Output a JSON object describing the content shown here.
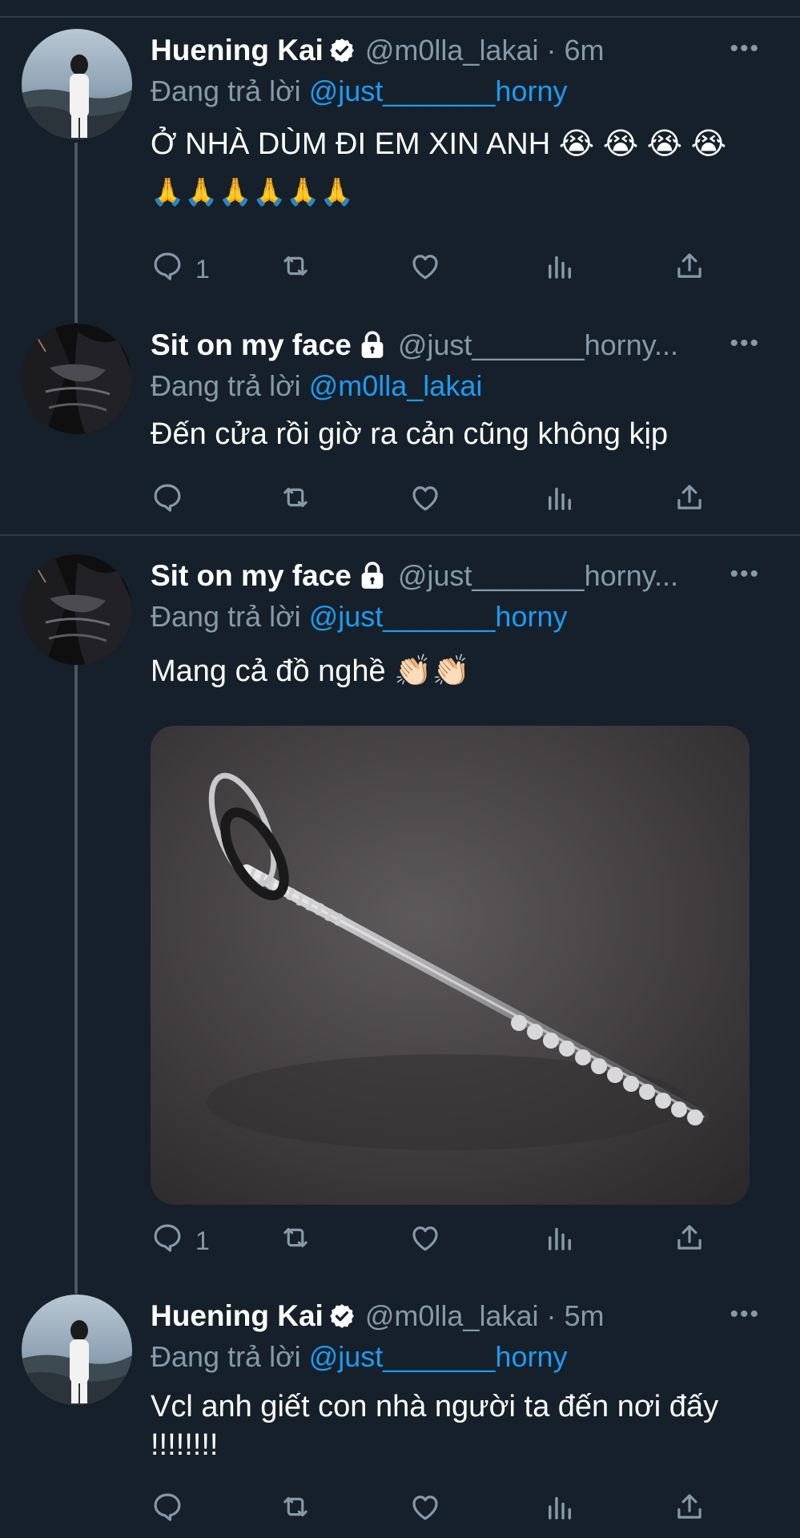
{
  "tweets": [
    {
      "name": "Huening Kai",
      "verified": true,
      "handle": "@m0lla_lakai · 6m",
      "reply_prefix": "Đang trả lời",
      "reply_to": "@just_______horny",
      "text_line1": "Ở NHÀ DÙM ĐI EM XIN ANH 😭 😭 😭 😭",
      "text_line2": "🙏🙏🙏🙏🙏🙏",
      "reply_count": "1"
    },
    {
      "name": "Sit on my face",
      "locked": true,
      "handle": "@just_______horny...",
      "reply_prefix": "Đang trả lời",
      "reply_to": "@m0lla_lakai",
      "text_line1": "Đến cửa rồi giờ ra cản cũng không kịp",
      "reply_count": ""
    },
    {
      "name": "Sit on my face",
      "locked": true,
      "handle": "@just_______horny...",
      "reply_prefix": "Đang trả lời",
      "reply_to": "@just_______horny",
      "text_line1": "Mang cả đồ nghề 👏🏻👏🏻",
      "reply_count": "1"
    },
    {
      "name": "Huening Kai",
      "verified": true,
      "handle": "@m0lla_lakai · 5m",
      "reply_prefix": "Đang trả lời",
      "reply_to": "@just_______horny",
      "text_line1": "Vcl anh giết con nhà người ta đến nơi đấy",
      "text_line2": "!!!!!!!!",
      "reply_count": ""
    }
  ],
  "icons": {
    "reply": "reply-icon",
    "retweet": "retweet-icon",
    "like": "heart-icon",
    "views": "analytics-icon",
    "share": "share-icon",
    "more": "more-icon"
  },
  "more_glyph": "•••",
  "colors": {
    "background": "#15202b",
    "text_secondary": "#8899a6",
    "accent": "#1d9bf0"
  }
}
